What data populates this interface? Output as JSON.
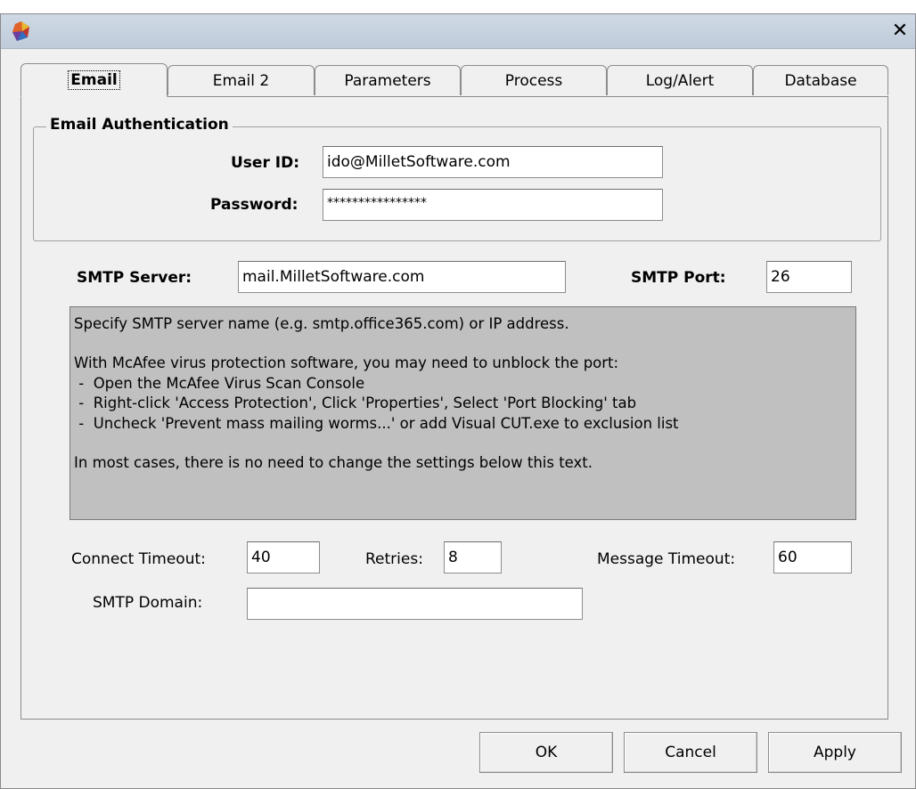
{
  "tabs": [
    "Email",
    "Email 2",
    "Parameters",
    "Process",
    "Log/Alert",
    "Database"
  ],
  "email_auth": {
    "legend": "Email Authentication",
    "user_id_label": "User ID:",
    "user_id_value": "ido@MilletSoftware.com",
    "password_label": "Password:",
    "password_value": "****************"
  },
  "smtp": {
    "server_label": "SMTP Server:",
    "server_value": "mail.MilletSoftware.com",
    "port_label": "SMTP Port:",
    "port_value": "26"
  },
  "info_lines": [
    "Specify SMTP server name (e.g. smtp.office365.com) or IP address.",
    "",
    "With McAfee virus protection software, you may need to unblock the port:",
    " -  Open the McAfee Virus Scan Console",
    " -  Right-click 'Access Protection', Click 'Properties', Select 'Port Blocking' tab",
    " -  Uncheck 'Prevent mass mailing worms...' or add Visual CUT.exe to exclusion list",
    "",
    "In most cases, there is no need to change the settings below this text."
  ],
  "timeouts": {
    "connect_label": "Connect Timeout:",
    "connect_value": "40",
    "retries_label": "Retries:",
    "retries_value": "8",
    "message_label": "Message Timeout:",
    "message_value": "60"
  },
  "domain": {
    "label": "SMTP Domain:",
    "value": ""
  },
  "buttons": {
    "ok": "OK",
    "cancel": "Cancel",
    "apply": "Apply"
  },
  "icons": {
    "app": "app-icon",
    "close": "close-icon"
  }
}
